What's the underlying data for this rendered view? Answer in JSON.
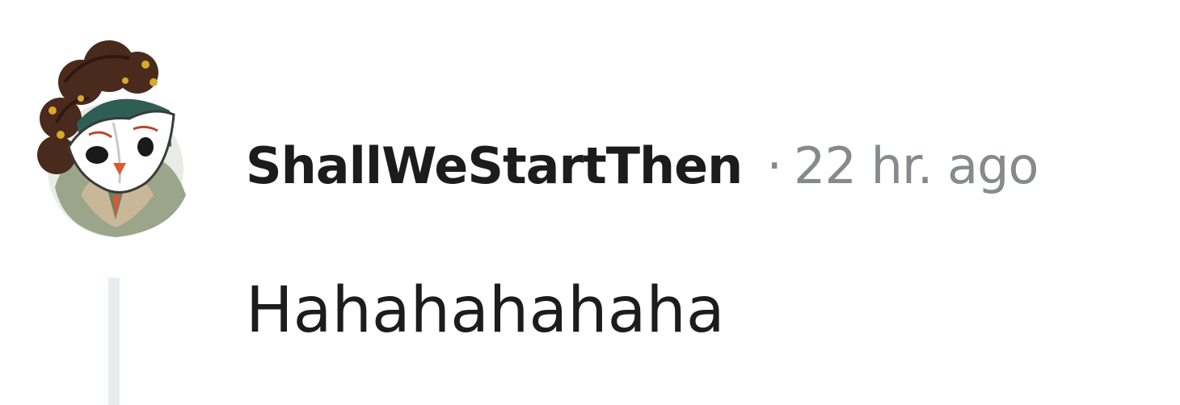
{
  "comment": {
    "author": "ShallWeStartThen",
    "separator": "·",
    "timestamp": "22 hr. ago",
    "body": "Hahahahahaha",
    "avatar_icon": "owl-mask-avatar-icon"
  },
  "colors": {
    "author_text": "#1c1c1c",
    "meta_text": "#878a8c",
    "thread_line": "#eaedef",
    "background": "#ffffff"
  }
}
